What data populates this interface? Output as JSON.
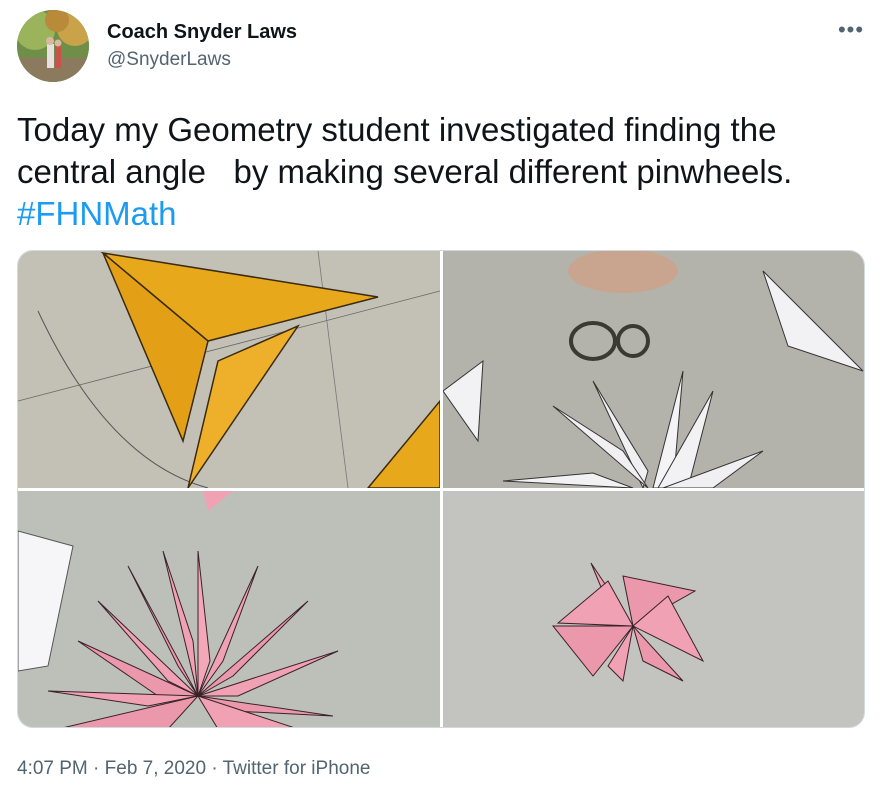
{
  "author": {
    "display_name": "Coach Snyder Laws",
    "handle": "@SnyderLaws",
    "avatar_icon": "profile-photo"
  },
  "more_icon": "ellipsis-icon",
  "more_glyph": "•••",
  "tweet": {
    "line1": "Today my Geometry student investigated finding the",
    "line2": "central angle   by making several different pinwheels.",
    "hashtag": "#FHNMath"
  },
  "media": {
    "photos": [
      {
        "name": "yellow-triangle-pinwheel",
        "fill": "#e8a81c"
      },
      {
        "name": "white-triangle-pinwheel",
        "fill": "#f2f2f4"
      },
      {
        "name": "pink-triangle-pinwheel-many",
        "fill": "#f0a2b4"
      },
      {
        "name": "pink-triangle-pinwheel-small",
        "fill": "#f0a2b4"
      }
    ]
  },
  "meta": {
    "time": "4:07 PM",
    "separator": " · ",
    "date": "Feb 7, 2020",
    "source": "Twitter for iPhone"
  },
  "colors": {
    "link": "#1d9bf0",
    "secondary_text": "#536471",
    "border": "#cfd9de"
  }
}
